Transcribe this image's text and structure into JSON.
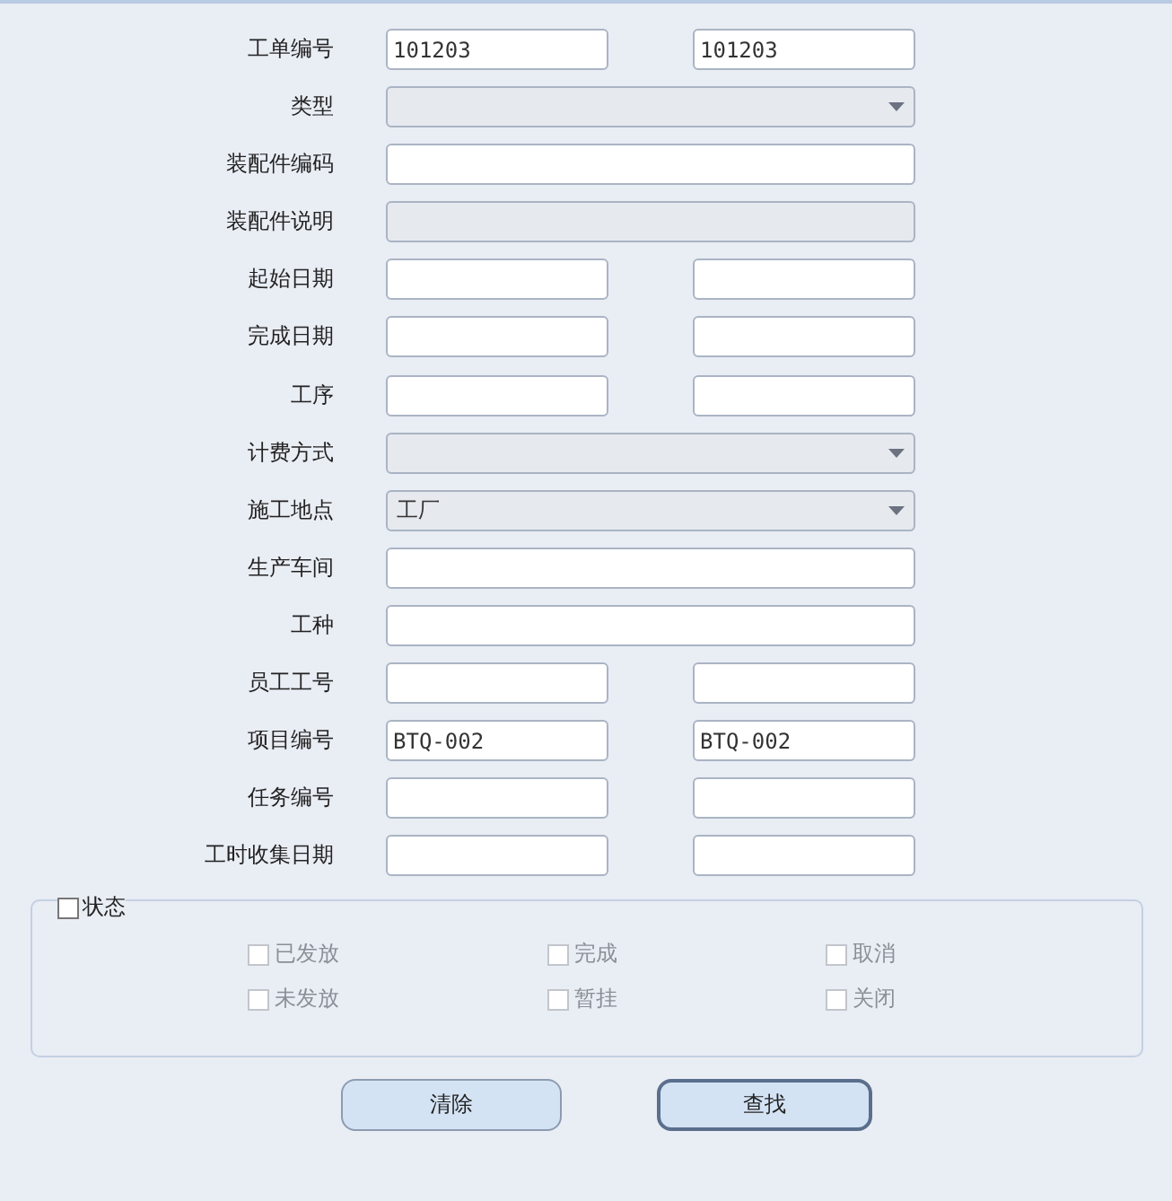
{
  "fields": [
    {
      "label": "工单编号",
      "kind": "range",
      "values": [
        "101203",
        "101203"
      ]
    },
    {
      "label": "类型",
      "kind": "select",
      "disabled": true
    },
    {
      "label": "装配件编码",
      "kind": "text"
    },
    {
      "label": "装配件说明",
      "kind": "text",
      "disabled": true
    },
    {
      "label": "起始日期",
      "kind": "range"
    },
    {
      "label": "完成日期",
      "kind": "range"
    },
    {
      "label": "工序",
      "kind": "range"
    },
    {
      "label": "计费方式",
      "kind": "select",
      "disabled": true
    },
    {
      "label": "施工地点",
      "kind": "select",
      "disabled": true,
      "value": "工厂"
    },
    {
      "label": "生产车间",
      "kind": "text"
    },
    {
      "label": "工种",
      "kind": "text"
    },
    {
      "label": "员工工号",
      "kind": "range"
    },
    {
      "label": "项目编号",
      "kind": "range",
      "values": [
        "BTQ-002",
        "BTQ-002"
      ]
    },
    {
      "label": "任务编号",
      "kind": "range"
    },
    {
      "label": "工时收集日期",
      "kind": "range"
    }
  ],
  "status": {
    "label": "状态",
    "checked": false,
    "options": [
      {
        "label": "已发放",
        "checked": false,
        "disabled": true
      },
      {
        "label": "完成",
        "checked": false,
        "disabled": true
      },
      {
        "label": "取消",
        "checked": false,
        "disabled": true
      },
      {
        "label": "未发放",
        "checked": false,
        "disabled": true
      },
      {
        "label": "暂挂",
        "checked": false,
        "disabled": true
      },
      {
        "label": "关闭",
        "checked": false,
        "disabled": true
      }
    ]
  },
  "buttons": [
    {
      "label": "清除",
      "default": false
    },
    {
      "label": "查找",
      "default": true
    }
  ]
}
